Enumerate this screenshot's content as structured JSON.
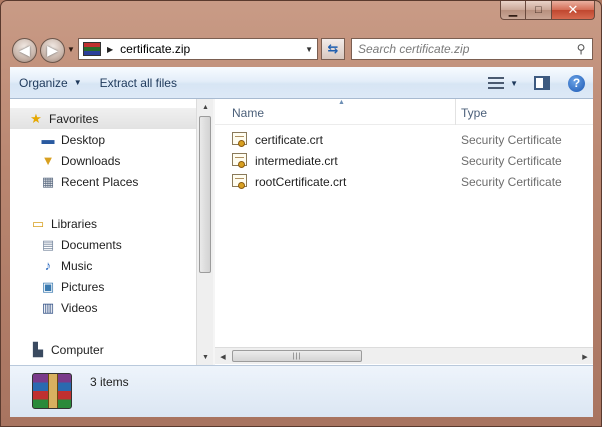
{
  "window": {
    "caption": {
      "minimize": "▁",
      "maximize": "□",
      "close": "✕"
    }
  },
  "address": {
    "back_icon": "arrow-left-icon",
    "forward_icon": "arrow-right-icon",
    "path": "certificate.zip",
    "refresh_icon": "refresh-icon"
  },
  "search": {
    "placeholder": "Search certificate.zip"
  },
  "toolbar": {
    "organize_label": "Organize",
    "extract_label": "Extract all files"
  },
  "nav": {
    "favorites": "Favorites",
    "favorites_items": [
      "Desktop",
      "Downloads",
      "Recent Places"
    ],
    "libraries": "Libraries",
    "libraries_items": [
      "Documents",
      "Music",
      "Pictures",
      "Videos"
    ],
    "computer": "Computer"
  },
  "files": {
    "columns": {
      "name": "Name",
      "type": "Type"
    },
    "rows": [
      {
        "name": "certificate.crt",
        "type": "Security Certificate"
      },
      {
        "name": "intermediate.crt",
        "type": "Security Certificate"
      },
      {
        "name": "rootCertificate.crt",
        "type": "Security Certificate"
      }
    ]
  },
  "status": {
    "count": "3 items"
  },
  "colors": {
    "frame": "#b98670",
    "toolbar": "#e4eef9",
    "header_text": "#4c607a",
    "type_text": "#6d6d6d"
  }
}
